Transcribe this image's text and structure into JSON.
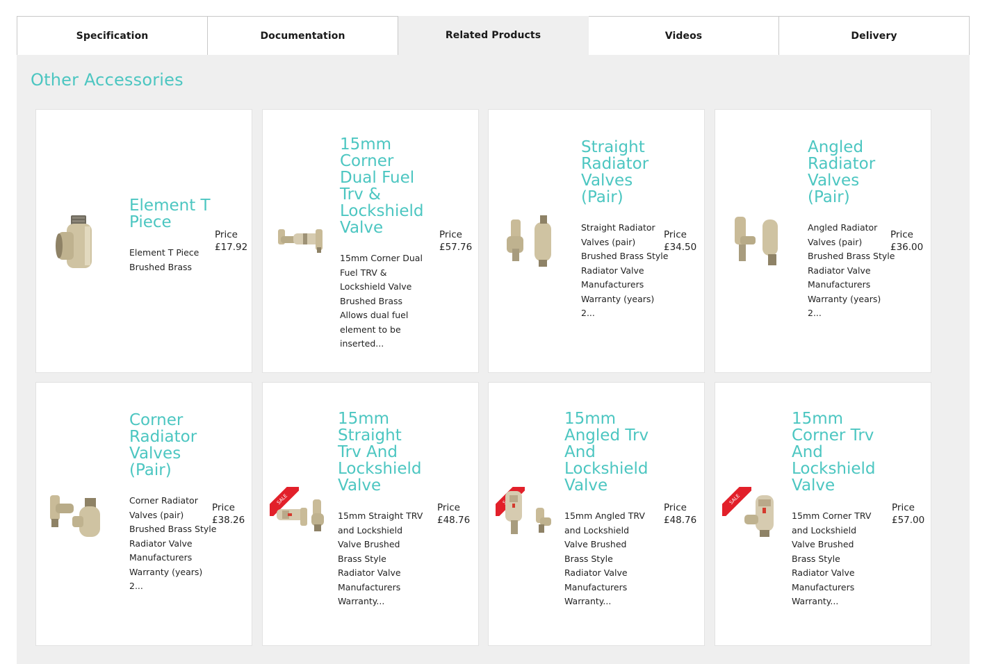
{
  "tabs": [
    {
      "label": "Specification"
    },
    {
      "label": "Documentation"
    },
    {
      "label": "Related Products"
    },
    {
      "label": "Videos"
    },
    {
      "label": "Delivery"
    }
  ],
  "section": {
    "title": "Other Accessories"
  },
  "price_label": "Price",
  "sale_label": "SALE",
  "products": [
    {
      "title": "Element T Piece",
      "description": "Element T Piece Brushed Brass",
      "price": "£17.92",
      "sale": false,
      "icon": "t-piece-icon"
    },
    {
      "title": "15mm Corner Dual Fuel Trv & Lockshield Valve",
      "description": "15mm Corner Dual Fuel TRV & Lockshield Valve Brushed Brass Allows dual fuel element to be inserted...",
      "price": "£57.76",
      "sale": false,
      "icon": "corner-dual-fuel-valve-icon"
    },
    {
      "title": "Straight Radiator Valves (Pair)",
      "description": "Straight Radiator Valves (pair) Brushed Brass Style Radiator Valve Manufacturers Warranty (years) 2...",
      "price": "£34.50",
      "sale": false,
      "icon": "straight-valves-icon"
    },
    {
      "title": "Angled Radiator Valves (Pair)",
      "description": "Angled Radiator Valves (pair) Brushed Brass Style Radiator Valve Manufacturers Warranty (years) 2...",
      "price": "£36.00",
      "sale": false,
      "icon": "angled-valves-icon"
    },
    {
      "title": "Corner Radiator Valves (Pair)",
      "description": "Corner Radiator Valves (pair) Brushed Brass Style Radiator Valve Manufacturers Warranty (years) 2...",
      "price": "£38.26",
      "sale": false,
      "icon": "corner-valves-icon"
    },
    {
      "title": "15mm Straight Trv And Lockshield Valve",
      "description": "15mm Straight TRV and Lockshield Valve Brushed Brass Style Radiator Valve Manufacturers Warranty...",
      "price": "£48.76",
      "sale": true,
      "icon": "straight-trv-icon"
    },
    {
      "title": "15mm Angled Trv And Lockshield Valve",
      "description": "15mm Angled TRV and Lockshield Valve Brushed Brass Style Radiator Valve Manufacturers Warranty...",
      "price": "£48.76",
      "sale": true,
      "icon": "angled-trv-icon"
    },
    {
      "title": "15mm Corner Trv And Lockshield Valve",
      "description": "15mm Corner TRV and Lockshield Valve Brushed Brass Style Radiator Valve Manufacturers Warranty...",
      "price": "£57.00",
      "sale": true,
      "icon": "corner-trv-icon"
    }
  ],
  "colors": {
    "accent": "#4cc6c1",
    "panel_bg": "#efefef",
    "sale_red": "#e2202a",
    "brass": "#c9bb98"
  }
}
